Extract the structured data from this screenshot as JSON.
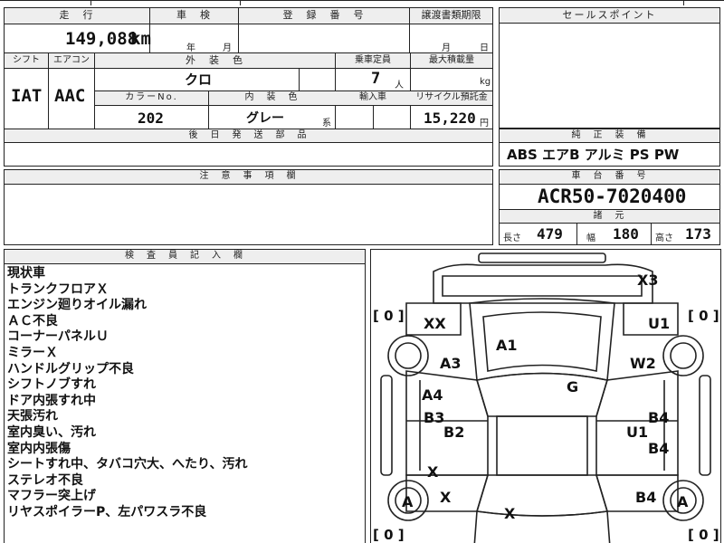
{
  "header": {
    "mileage_label": "走　行",
    "mileage_value": "149,088",
    "mileage_unit": "km",
    "inspection_label": "車　検",
    "inspection_year_unit": "年",
    "inspection_month_unit": "月",
    "registration_label": "登　録　番　号",
    "transfer_label": "譲渡書類期限",
    "transfer_month_unit": "月",
    "transfer_day_unit": "日",
    "sales_point_label": "セールスポイント"
  },
  "spec": {
    "shift_label": "シフト",
    "shift_value": "IAT",
    "aircon_label": "エアコン",
    "aircon_value": "AAC",
    "exterior_color_label": "外　装　色",
    "exterior_color_value": "クロ",
    "capacity_label": "乗車定員",
    "capacity_value": "7",
    "capacity_unit": "人",
    "max_load_label": "最大積載量",
    "max_load_unit": "kg",
    "color_no_label": "カラーNo.",
    "color_no_value": "202",
    "interior_color_label": "内　装　色",
    "interior_color_value": "グレー",
    "interior_color_unit": "系",
    "import_label": "輸入車",
    "recycle_label": "リサイクル預託金",
    "recycle_value": "15,220",
    "recycle_unit": "円",
    "later_parts_label": "後　日　発　送　部　品"
  },
  "equipment": {
    "label": "純　正　装　備",
    "value": "ABS エアB アルミ PS PW"
  },
  "notes": {
    "label": "注　意　事　項　欄"
  },
  "chassis": {
    "label": "車　台　番　号",
    "value": "ACR50-7020400",
    "specs_label": "諸　元",
    "length_label": "長さ",
    "length_value": "479",
    "width_label": "幅",
    "width_value": "180",
    "height_label": "高さ",
    "height_value": "173"
  },
  "inspector": {
    "label": "検　査　員　記　入　欄",
    "lines": [
      "現状車",
      "トランクフロアＸ",
      "エンジン廻りオイル漏れ",
      "ＡＣ不良",
      "コーナーパネルＵ",
      "ミラーＸ",
      "ハンドルグリップ不良",
      "シフトノブすれ",
      "ドア内張すれ中",
      "天張汚れ",
      "室内臭い、汚れ",
      "室内内張傷",
      "シートすれ中、タバコ穴大、へたり、汚れ",
      "ステレオ不良",
      "マフラー突上げ",
      "リヤスポイラーP、左パワスラ不良"
    ]
  },
  "diagram": {
    "tire_left_top": "[ 0 ]",
    "tire_right_top": "[ 0 ]",
    "tire_left_bottom": "[ 0 ]",
    "tire_right_bottom": "[ 0 ]",
    "marks": {
      "x3": "X3",
      "xx": "XX",
      "u1_top": "U1",
      "a1": "A1",
      "a3": "A3",
      "w2": "W2",
      "g": "G",
      "a4": "A4",
      "b3": "B3",
      "b2": "B2",
      "b4_upper": "B4",
      "u1_mid": "U1",
      "b4_mid": "B4",
      "x_left": "X",
      "x_left2": "X",
      "b4_lower": "B4",
      "a_left": "A",
      "a_right": "A",
      "x_bottom": "X"
    }
  }
}
